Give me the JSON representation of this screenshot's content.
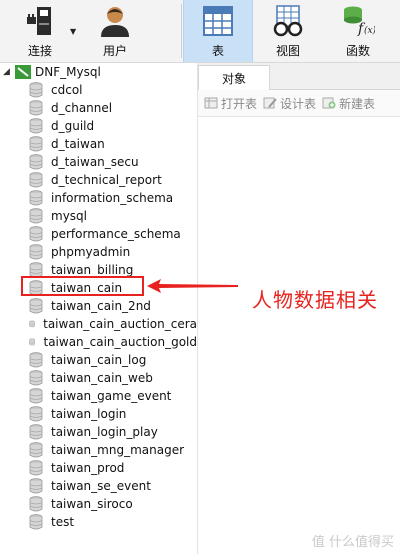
{
  "toolbar": {
    "connect_label": "连接",
    "user_label": "用户",
    "table_label": "表",
    "view_label": "视图",
    "function_label": "函数"
  },
  "tree": {
    "connection": "DNF_Mysql",
    "databases": [
      "cdcol",
      "d_channel",
      "d_guild",
      "d_taiwan",
      "d_taiwan_secu",
      "d_technical_report",
      "information_schema",
      "mysql",
      "performance_schema",
      "phpmyadmin",
      "taiwan_billing",
      "taiwan_cain",
      "taiwan_cain_2nd",
      "taiwan_cain_auction_cera",
      "taiwan_cain_auction_gold",
      "taiwan_cain_log",
      "taiwan_cain_web",
      "taiwan_game_event",
      "taiwan_login",
      "taiwan_login_play",
      "taiwan_mng_manager",
      "taiwan_prod",
      "taiwan_se_event",
      "taiwan_siroco",
      "test"
    ]
  },
  "object_pane": {
    "tab_label": "对象",
    "open_table": "打开表",
    "design_table": "设计表",
    "new_table": "新建表"
  },
  "annotation": {
    "note": "人物数据相关"
  },
  "watermark": "值 什么值得买",
  "colors": {
    "highlight": "#e8231f",
    "active_tab": "#c9e1f7"
  }
}
